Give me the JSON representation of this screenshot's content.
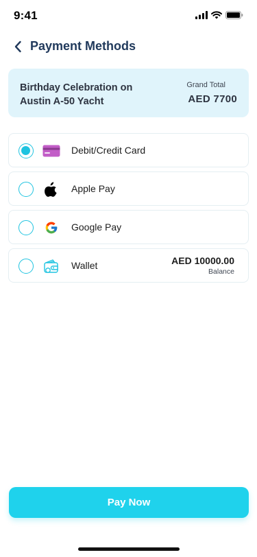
{
  "status_bar": {
    "time": "9:41"
  },
  "header": {
    "title": "Payment Methods",
    "back_icon": "chevron-left-icon"
  },
  "summary": {
    "title": "Birthday Celebration on Austin A-50 Yacht",
    "total_label": "Grand Total",
    "total_value": "AED 7700"
  },
  "methods": [
    {
      "label": "Debit/Credit Card",
      "icon": "credit-card-icon",
      "selected": true
    },
    {
      "label": "Apple Pay",
      "icon": "apple-icon",
      "selected": false
    },
    {
      "label": "Google Pay",
      "icon": "google-icon",
      "selected": false
    },
    {
      "label": "Wallet",
      "icon": "wallet-icon",
      "selected": false,
      "amount": "AED 10000.00",
      "sub": "Balance"
    }
  ],
  "pay_button": {
    "label": "Pay Now"
  },
  "colors": {
    "accent": "#1fd2ec",
    "summary_bg": "#e0f4fb",
    "title": "#213a5c"
  }
}
